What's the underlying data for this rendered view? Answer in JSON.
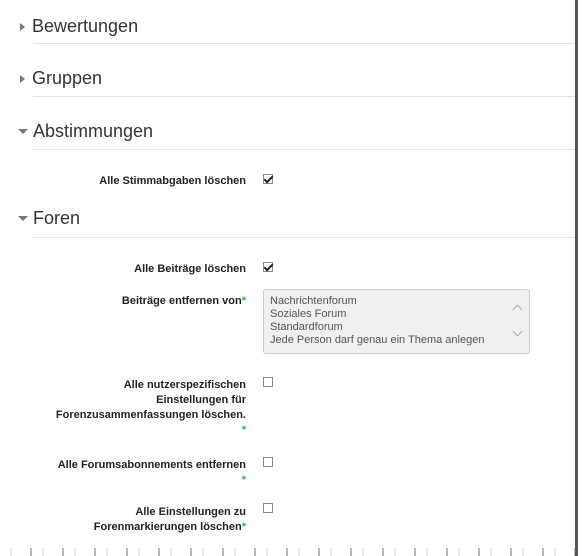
{
  "sections": {
    "bewertungen": "Bewertungen",
    "gruppen": "Gruppen",
    "abstimmungen": "Abstimmungen",
    "foren": "Foren"
  },
  "abstimmungen": {
    "delete_votes_label": "Alle Stimmabgaben löschen",
    "delete_votes_checked": true
  },
  "foren": {
    "delete_posts_label": "Alle Beiträge löschen",
    "delete_posts_checked": true,
    "remove_from_label": "Beiträge entfernen von",
    "remove_from_options": [
      "Nachrichtenforum",
      "Soziales Forum",
      "Standardforum",
      "Jede Person darf genau ein Thema anlegen"
    ],
    "user_settings_label_1": "Alle nutzerspezifischen",
    "user_settings_label_2": "Einstellungen für",
    "user_settings_label_3": "Forenzusammenfassungen löschen.",
    "subscriptions_label": "Alle Forumsabonnements entfernen",
    "markings_label_1": "Alle Einstellungen zu",
    "markings_label_2": "Forenmarkierungen löschen",
    "required_marker": "*"
  }
}
